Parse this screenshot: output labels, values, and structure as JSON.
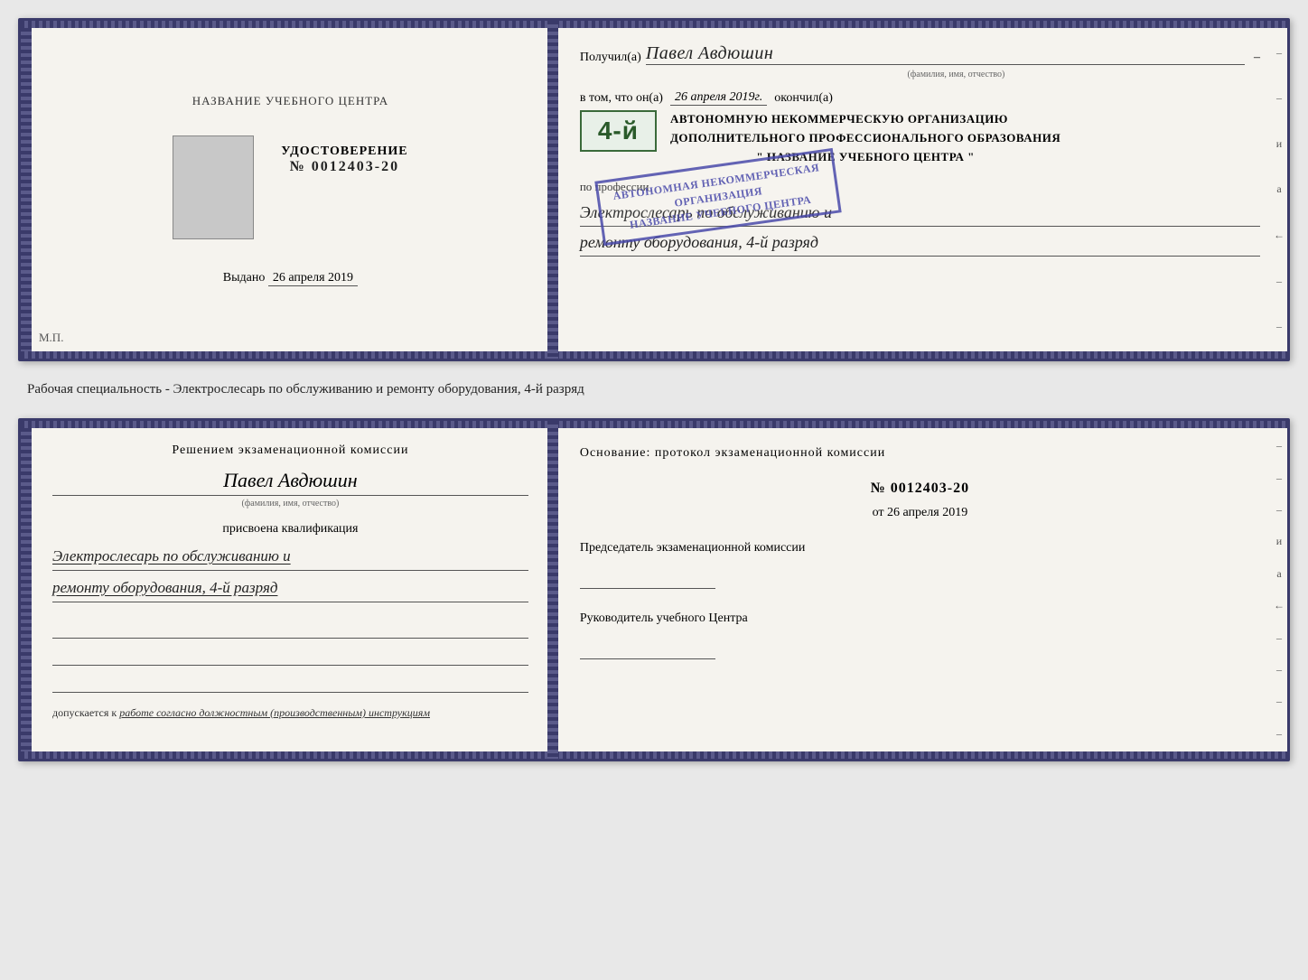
{
  "topDoc": {
    "left": {
      "title": "НАЗВАНИЕ УЧЕБНОГО ЦЕНТРА",
      "cert_label": "УДОСТОВЕРЕНИЕ",
      "cert_number_prefix": "№",
      "cert_number": "0012403-20",
      "issued_label": "Выдано",
      "issued_date": "26 апреля 2019",
      "mp_label": "М.П."
    },
    "right": {
      "received_prefix": "Получил(а)",
      "received_name": "Павел Авдюшин",
      "fio_hint": "(фамилия, имя, отчество)",
      "dash": "–",
      "in_that_prefix": "в том, что он(а)",
      "completion_date": "26 апреля 2019г.",
      "finished_label": "окончил(а)",
      "grade_badge": "4-й",
      "org_line1": "АВТОНОМНУЮ НЕКОММЕРЧЕСКУЮ ОРГАНИЗАЦИЮ",
      "org_line2": "ДОПОЛНИТЕЛЬНОГО ПРОФЕССИОНАЛЬНОГО ОБРАЗОВАНИЯ",
      "org_name": "\" НАЗВАНИЕ УЧЕБНОГО ЦЕНТРА \"",
      "profession_label": "по профессии",
      "profession_line1": "Электрослесарь по обслуживанию и",
      "profession_line2": "ремонту оборудования, 4-й разряд"
    }
  },
  "label": {
    "text": "Рабочая специальность - Электрослесарь по обслуживанию и ремонту оборудования, 4-й разряд"
  },
  "bottomDoc": {
    "left": {
      "decision_text": "Решением экзаменационной комиссии",
      "person_name": "Павел Авдюшин",
      "fio_hint": "(фамилия, имя, отчество)",
      "assigned_text": "присвоена квалификация",
      "qualification_line1": "Электрослесарь по обслуживанию и",
      "qualification_line2": "ремонту оборудования, 4-й разряд",
      "allowed_prefix": "допускается к",
      "allowed_work": "работе согласно должностным (производственным) инструкциям"
    },
    "right": {
      "basis_text": "Основание: протокол экзаменационной комиссии",
      "number_prefix": "№",
      "number": "0012403-20",
      "date_prefix": "от",
      "date": "26 апреля 2019",
      "chairman_label": "Председатель экзаменационной комиссии",
      "director_label": "Руководитель учебного Центра"
    },
    "right_dashes": [
      "–",
      "–",
      "–",
      "и",
      "а",
      "←",
      "–",
      "–",
      "–",
      "–"
    ]
  }
}
